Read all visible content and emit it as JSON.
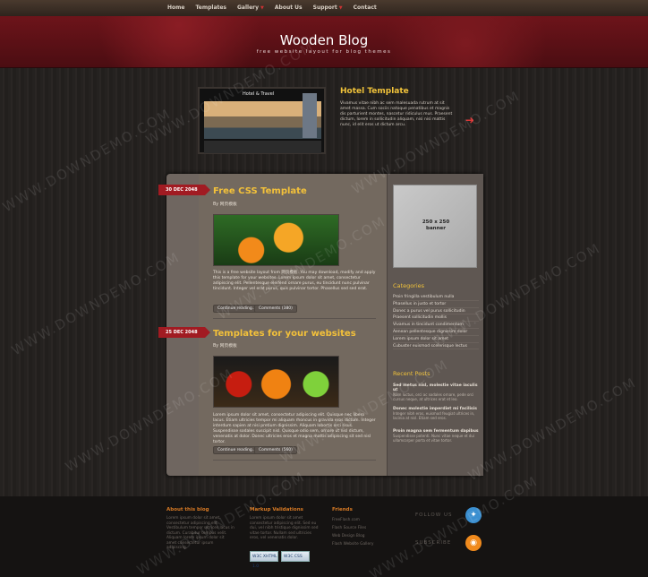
{
  "nav": {
    "items": [
      "Home",
      "Templates",
      "Gallery",
      "About Us",
      "Support",
      "Contact"
    ]
  },
  "header": {
    "title": "Wooden Blog",
    "subtitle": "free website layout for blog themes"
  },
  "featured": {
    "image_title": "Hotel & Travel",
    "title": "Hotel Template",
    "text": "Vivamus vitae nibh ac sem malesuada rutrum at sit amet massa. Cum sociis natoque penatibus et magnis dis parturient montes, nascetur ridiculus mus. Praesent dictum, lorem in sollicitudin aliquam, nisi nisi mattis nunc, id elit eros ut dictum arcu."
  },
  "posts": [
    {
      "date": "30 DEC 2048",
      "title": "Free CSS Template",
      "by": "By 网页模板",
      "text": "This is a free website layout from 网页模板. You may download, modify and apply this template for your websites. Lorem ipsum dolor sit amet, consectetur adipiscing elit. Pellentesque eleifend ornare purus, eu tincidunt nunc pulvinar tincidunt. Integer vel erat purus, quis pulvinar tortor. Phasellus sed sed erat.",
      "continue": "Continue reading...",
      "comments": "Comments (380)"
    },
    {
      "date": "25 DEC 2048",
      "title": "Templates for your websites",
      "by": "By 网页模板",
      "text": "Lorem ipsum dolor sit amet, consectetur adipiscing elit. Quisque nec libero lacus. Etiam ultricies tempor mi aliquam rhoncus in gravida eros dictum. Integer interdum sapien at nisi pretium dignissim. Aliquam lobortis orci risus. Suspendisse sodales suscipit nisl. Quisque odio sem, ornare ut nisl dictum, venenatis at dolor. Donec ultricies eros et magna mattis adipiscing sit sed nisl tortor.",
      "continue": "Continue reading...",
      "comments": "Comments (560)"
    }
  ],
  "sidebar": {
    "banner": "250 x 250\nbanner",
    "categories_title": "Categories",
    "categories": [
      "Proin fringilla vestibulum nulla",
      "Phasellus in justo et tortor",
      "Donec a purus vel purus sollicitudin",
      "Praesent sollicitudin mollis",
      "Vivamus in tincidunt condimentum",
      "Aenean pellentesque dignissim dolor",
      "Lorem ipsum dolor sit amet",
      "Cubuster euismod scelerisque lectus"
    ],
    "recent_title": "Recent Posts",
    "recent": [
      {
        "title": "Sed metus nisl, molestie vitae iaculis ut",
        "desc": "Nam luctus, orci ac sodales ornare, pede orci cursus neque, at ultrices erat et leo."
      },
      {
        "title": "Donec molestie imperdiet mi facilisis",
        "desc": "Integer nibh eros, euismod feugiat ultrices in, lacinia at nisl. Etiam sed eros."
      },
      {
        "title": "Proin magna sem fermentum dapibus",
        "desc": "Suspendisse potenti. Nunc vitae neque et dui ullamcorper porta et vitae tortor."
      }
    ]
  },
  "footer": {
    "about_title": "About this blog",
    "about_text": "Lorem ipsum dolor sit amet, consectetur adipiscing elit. Vestibulum tempor ultrices lacus in dictum. Curabitur tempus velit. Aliquam lorem ipsum dolor sit amet consectetur ipsum adipiscing.",
    "markup_title": "Markup Validations",
    "markup_text": "Lorem ipsum dolor sit amet consectetur adipiscing elit. Sed eu dui, vel nibh tristique dignissim sed vitae tortor. Nullam sed ultricies eros, vel venenatis dolor.",
    "badge1": "W3C XHTML 1.0",
    "badge2": "W3C CSS",
    "friends_title": "Friends",
    "friends": [
      "FreeFlash.com",
      "Flash Source Files",
      "Web Design Blog",
      "Flash Website Gallery"
    ],
    "follow": "FOLLOW US",
    "subscribe": "SUBSCRIBE",
    "colors": {
      "accent": "#f0c23a",
      "date": "#a11b22",
      "footer_head": "#d77a25"
    }
  },
  "watermark": "WWW.DOWNDEMO.COM"
}
